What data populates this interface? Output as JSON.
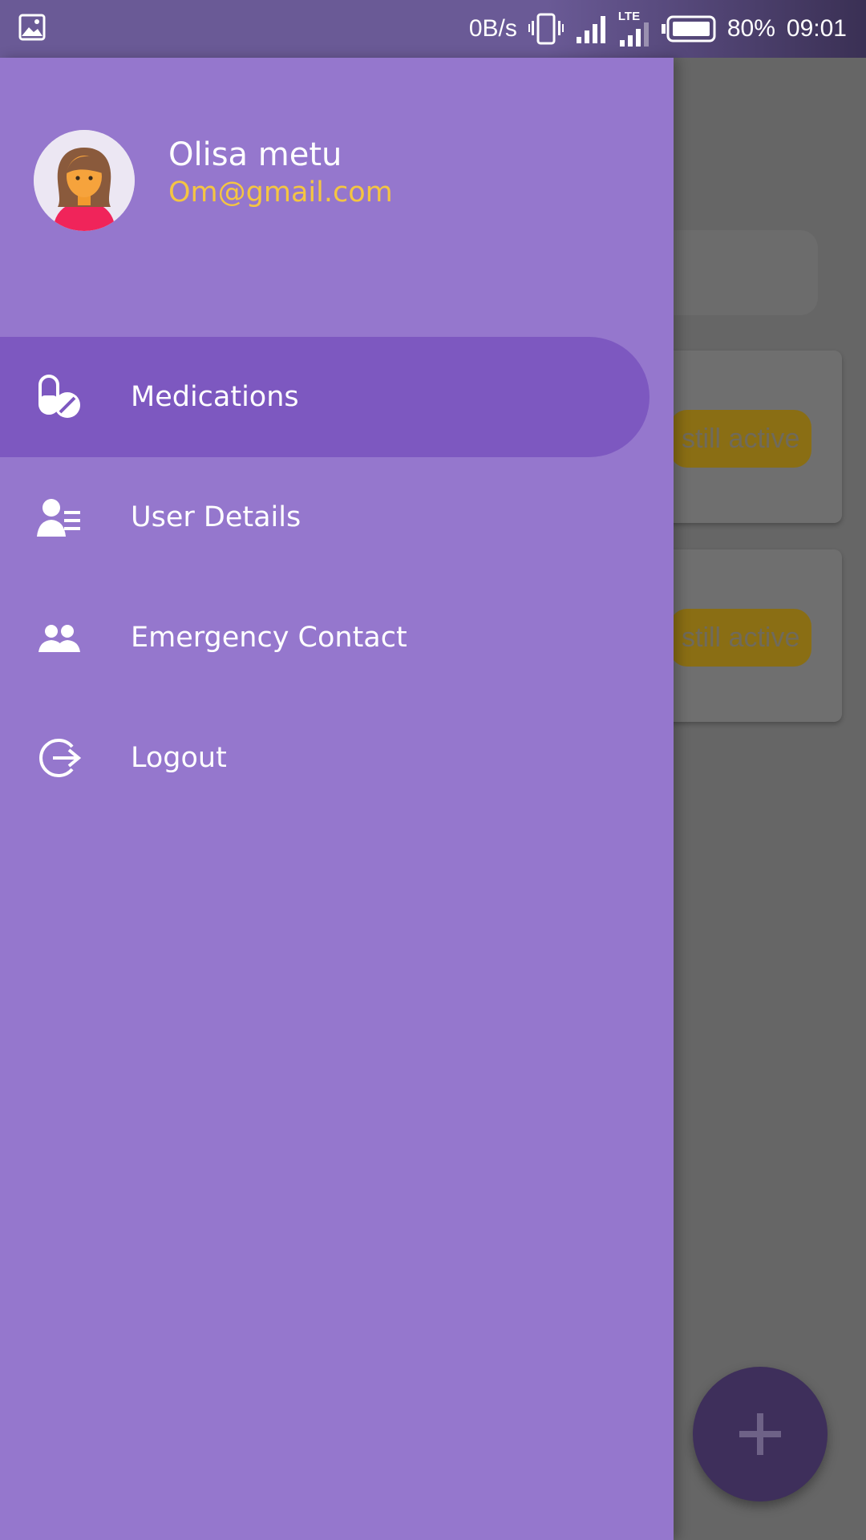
{
  "status_bar": {
    "net_speed": "0B/s",
    "network_type": "LTE",
    "battery": "80%",
    "time": "09:01",
    "icons": [
      "image-icon",
      "vibrate-icon",
      "signal-icon",
      "lte-signal-icon",
      "battery-icon"
    ]
  },
  "drawer": {
    "user": {
      "name": "Olisa metu",
      "email": "Om@gmail.com"
    },
    "menu": [
      {
        "label": "Medications",
        "icon": "pill-icon",
        "active": true
      },
      {
        "label": "User Details",
        "icon": "user-details-icon",
        "active": false
      },
      {
        "label": "Emergency Contact",
        "icon": "people-icon",
        "active": false
      },
      {
        "label": "Logout",
        "icon": "logout-icon",
        "active": false
      }
    ]
  },
  "background": {
    "cards": [
      {
        "badge": "still active"
      },
      {
        "badge": "still active"
      }
    ],
    "fab_icon": "plus-icon"
  },
  "colors": {
    "drawer_bg": "#9577cd",
    "active_item_bg": "#7d58c0",
    "email_color": "#f4c542",
    "fab_bg": "#3e2f5b"
  }
}
